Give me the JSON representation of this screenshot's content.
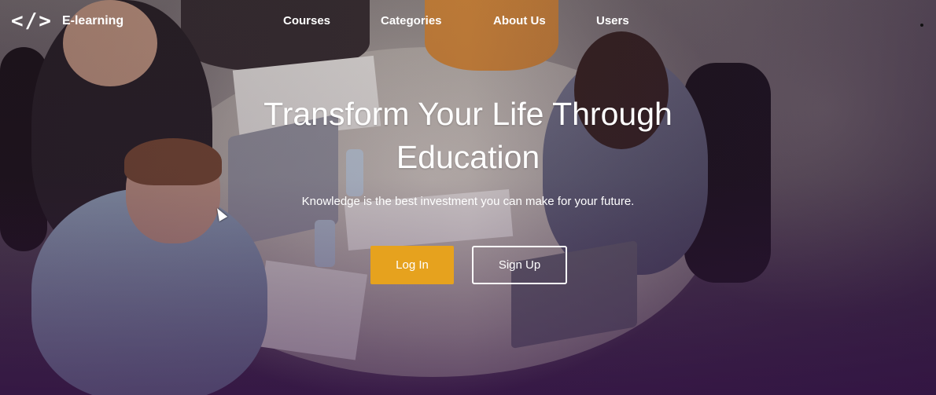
{
  "brand": {
    "icon": "code-icon",
    "icon_glyph": "</>",
    "name": "E-learning"
  },
  "nav": {
    "items": [
      {
        "label": "Courses"
      },
      {
        "label": "Categories"
      },
      {
        "label": "About Us"
      },
      {
        "label": "Users"
      }
    ]
  },
  "hero": {
    "title": "Transform Your Life Through Education",
    "subtitle": "Knowledge is the best investment you can make for your future.",
    "login_label": "Log In",
    "signup_label": "Sign Up"
  },
  "colors": {
    "accent": "#e6a21e",
    "text": "#ffffff",
    "overlay": "#341046"
  }
}
